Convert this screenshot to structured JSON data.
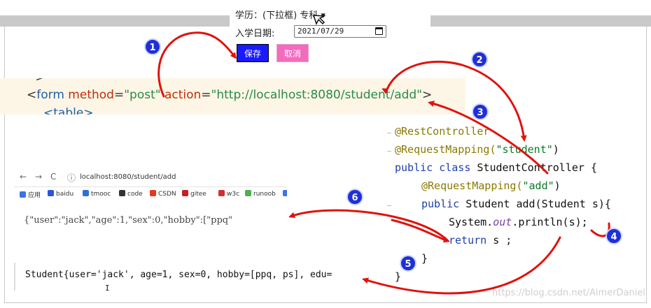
{
  "form": {
    "partial_top_text": "学历：(下拉框) 专科 ▾",
    "date_label": "入学日期:",
    "date_value": "2021/07/29",
    "save_label": "保存",
    "cancel_label": "取消"
  },
  "html_code": {
    "fragment_top": "-->",
    "fragment_bottom": "<table>",
    "lt": "<",
    "tag": "form",
    "attr_method": "method",
    "eq": "=",
    "val_method": "\"post\"",
    "attr_action": "action",
    "val_action": "\"http://localhost:8080/student/add\"",
    "gt": ">"
  },
  "browser": {
    "back": "←",
    "forward": "→",
    "reload": "C",
    "info": "ⓘ",
    "url": "localhost:8080/student/add",
    "bookmarks": [
      {
        "label": "应用",
        "color": "#3b73e8"
      },
      {
        "label": "baidu",
        "color": "#2b55d8"
      },
      {
        "label": "tmooc",
        "color": "#2f6fd8"
      },
      {
        "label": "code",
        "color": "#333333"
      },
      {
        "label": "CSDN",
        "color": "#e23a1e"
      },
      {
        "label": "gitee",
        "color": "#c71d23"
      },
      {
        "label": "w3c",
        "color": "#d32f2f"
      },
      {
        "label": "runoob",
        "color": "#4caf50"
      },
      {
        "label": "",
        "color": "#3b73e8"
      }
    ],
    "output": "{\"user\":\"jack\",\"age\":1,\"sex\":0,\"hobby\":[\"ppq\""
  },
  "console": {
    "output": "Student{user='jack', age=1, sex=0, hobby=[ppq, ps], edu=",
    "cursor": "I"
  },
  "java": {
    "l1": "@RestController",
    "l2_ann": "@RequestMapping(",
    "l2_str": "\"student\"",
    "l2_end": ")",
    "l3_kw": "public class",
    "l3_rest": " StudentController {",
    "l4_ann": "@RequestMapping(",
    "l4_str": "\"add\"",
    "l4_end": ")",
    "l5_kw": "public",
    "l5_rest": " Student add(Student s){",
    "l6_a": "System.",
    "l6_it": "out",
    "l6_b": ".println(s);",
    "l7_kw": "return",
    "l7_rest": " s ;",
    "l8": "}",
    "l9": "}"
  },
  "steps": [
    "1",
    "2",
    "3",
    "4",
    "5",
    "6"
  ],
  "watermark": "https://blog.csdn.net/AimerDaniel",
  "colors": {
    "arrow": "#e0120c",
    "badge": "#1f2fd8",
    "save_button": "#1a1aff",
    "cancel_button": "#f36bbd",
    "code_background": "#fdf6e6"
  }
}
